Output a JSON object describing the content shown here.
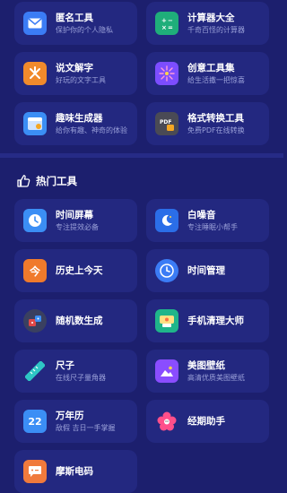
{
  "top_tools": [
    {
      "title": "匿名工具",
      "subtitle": "保护你的个人隐私",
      "icon": "mail-icon",
      "color": "#3b7cf5"
    },
    {
      "title": "计算器大全",
      "subtitle": "千奇百怪的计算器",
      "icon": "calculator-icon",
      "color": "#1fae7a"
    },
    {
      "title": "说文解字",
      "subtitle": "好玩的文字工具",
      "icon": "character-icon",
      "color": "#f08a2c"
    },
    {
      "title": "创意工具集",
      "subtitle": "给生活撒一把惊喜",
      "icon": "fireworks-icon",
      "color": "#7c4dff"
    },
    {
      "title": "趣味生成器",
      "subtitle": "给你有趣、神奇的体验",
      "icon": "browser-icon",
      "color": "#3b8ef5"
    },
    {
      "title": "格式转换工具",
      "subtitle": "免费PDF在线转换",
      "icon": "pdf-icon",
      "color": "#4a4a55"
    }
  ],
  "hot_section": {
    "title": "热门工具",
    "icon": "thumbs-up-icon"
  },
  "hot_tools": [
    {
      "title": "时间屏幕",
      "subtitle": "专注提效必备",
      "icon": "clock-icon",
      "color": "#3b8ef5"
    },
    {
      "title": "白噪音",
      "subtitle": "专注睡眠小帮手",
      "icon": "moon-icon",
      "color": "#2b6ee8"
    },
    {
      "title": "历史上今天",
      "subtitle": "",
      "icon": "calendar-today-icon",
      "color": "#f07a2c",
      "glyph": "今"
    },
    {
      "title": "时间管理",
      "subtitle": "",
      "icon": "clock-icon",
      "color": "#3b7cf5"
    },
    {
      "title": "随机数生成",
      "subtitle": "",
      "icon": "dice-icon",
      "color": "#3a4060"
    },
    {
      "title": "手机清理大师",
      "subtitle": "",
      "icon": "cleaner-icon",
      "color": "#1fb58a"
    },
    {
      "title": "尺子",
      "subtitle": "在线尺子量角器",
      "icon": "ruler-icon",
      "color": "#2ec5c5"
    },
    {
      "title": "美图壁纸",
      "subtitle": "高清优质美图壁纸",
      "icon": "image-icon",
      "color": "#8a4dff"
    },
    {
      "title": "万年历",
      "subtitle": "敌假 吉日一手掌握",
      "icon": "calendar-22-icon",
      "color": "#3b8ef5",
      "glyph": "22"
    },
    {
      "title": "经期助手",
      "subtitle": "",
      "icon": "flower-icon",
      "color": "#ff4f8a"
    },
    {
      "title": "摩斯电码",
      "subtitle": "",
      "icon": "chat-icon",
      "color": "#f07a3c"
    }
  ]
}
